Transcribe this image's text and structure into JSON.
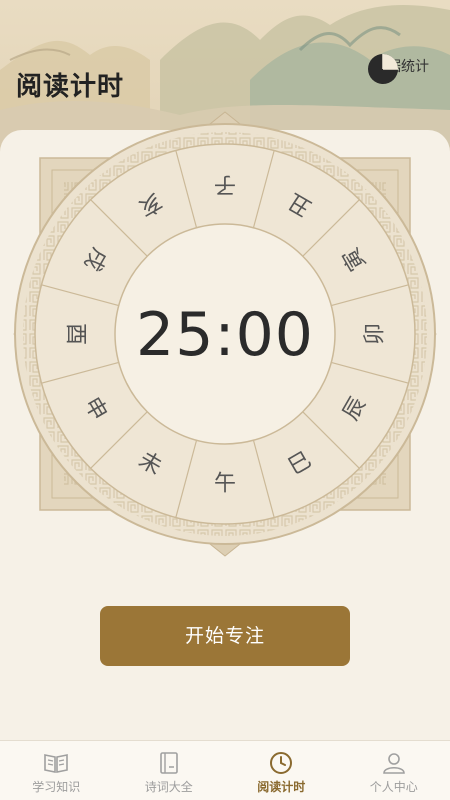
{
  "header": {
    "title": "阅读计时",
    "stats_label": "数据统计"
  },
  "timer": {
    "display": "25:00",
    "branches": [
      "子",
      "丑",
      "寅",
      "卯",
      "辰",
      "巳",
      "午",
      "未",
      "申",
      "酉",
      "戌",
      "亥"
    ]
  },
  "actions": {
    "start_label": "开始专注"
  },
  "tabbar": {
    "items": [
      {
        "label": "学习知识",
        "icon": "book-open-icon",
        "active": false
      },
      {
        "label": "诗词大全",
        "icon": "book-icon",
        "active": false
      },
      {
        "label": "阅读计时",
        "icon": "clock-icon",
        "active": true
      },
      {
        "label": "个人中心",
        "icon": "user-icon",
        "active": false
      }
    ]
  },
  "colors": {
    "accent": "#9b7637",
    "active_tab": "#8a6a2f",
    "inactive_tab": "#9d9d9d",
    "background": "#f6f1e7",
    "dial_ring": "#e8dcc6"
  }
}
